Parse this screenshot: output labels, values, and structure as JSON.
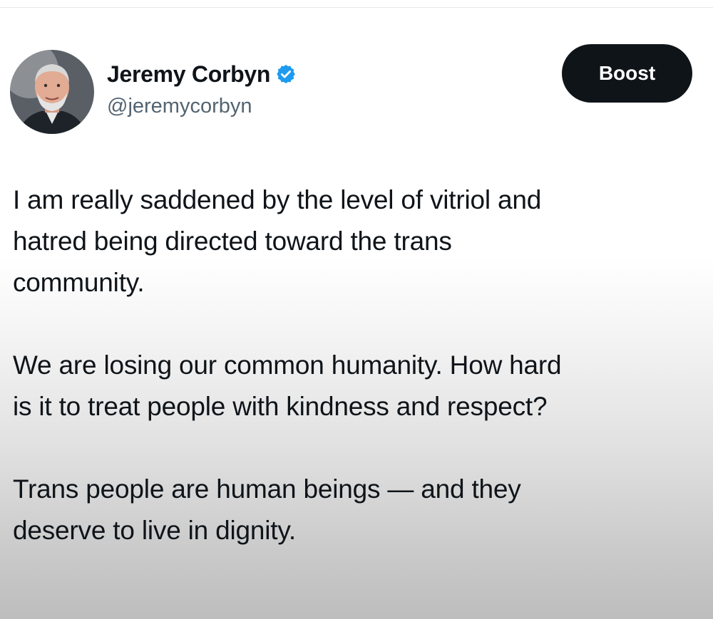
{
  "colors": {
    "verified_badge": "#1d9bf0",
    "boost_background": "#0f1419",
    "handle_text": "#536471"
  },
  "author": {
    "display_name": "Jeremy Corbyn",
    "handle": "@jeremycorbyn",
    "verified_icon": "verified-badge-icon",
    "avatar": "profile-photo"
  },
  "actions": {
    "boost_label": "Boost"
  },
  "tweet": {
    "paragraphs": [
      "I am really saddened by the level of vitriol and\nhatred being directed toward the trans\ncommunity.",
      "We are losing our common humanity. How hard\nis it to treat people with kindness and respect?",
      "Trans people are human beings — and they\ndeserve to live in dignity."
    ]
  }
}
